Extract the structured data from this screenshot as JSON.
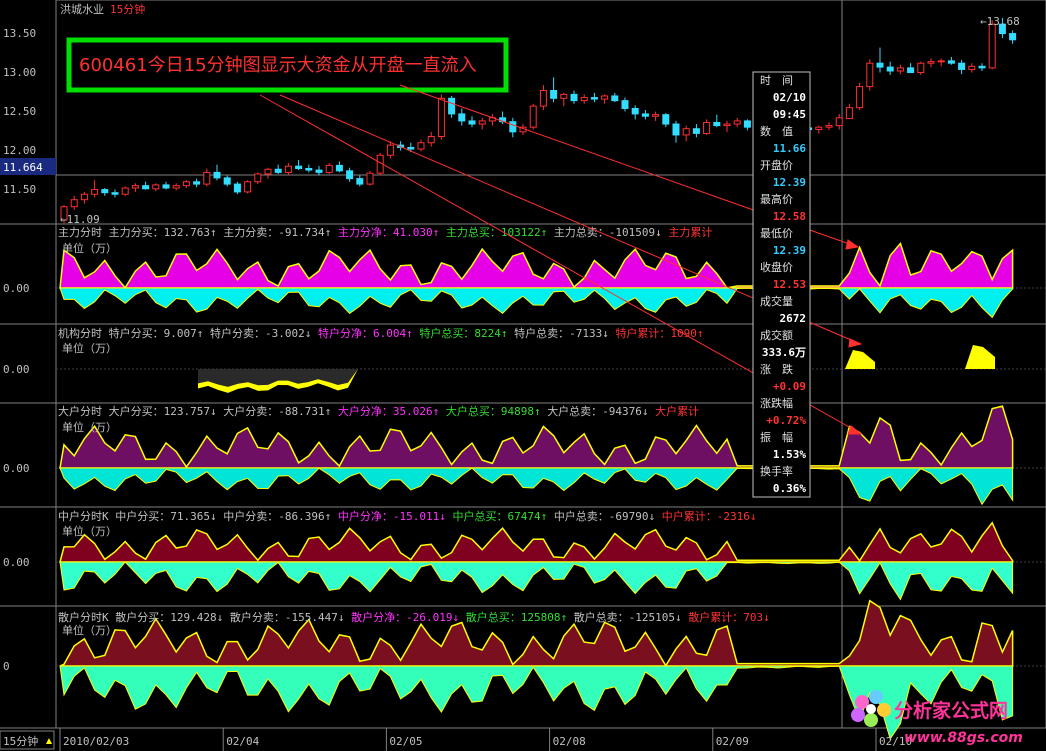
{
  "header": {
    "stock_name": "洪城水业",
    "period": "15分钟"
  },
  "annotation": "600461今日15分钟图显示大资金从开盘一直流入",
  "price_panel": {
    "y_ticks": [
      "13.50",
      "13.00",
      "12.50",
      "12.00",
      "11.50"
    ],
    "current_price": "11.664",
    "high_marker": "13.68",
    "low_marker": "11.09"
  },
  "panels": [
    {
      "id": "zhuli",
      "zero_label": "0.00",
      "unit": "单位（万）",
      "legend": [
        {
          "text": "主力分时",
          "color": "#c0c0c0"
        },
        {
          "text": "主力分买：132.763↑",
          "color": "#c0c0c0"
        },
        {
          "text": "主力分卖：-91.734↑",
          "color": "#c0c0c0"
        },
        {
          "text": "主力分净：41.030↑",
          "color": "#ff33ff"
        },
        {
          "text": "主力总买：103122↑",
          "color": "#33dd33"
        },
        {
          "text": "主力总卖：-101509↓",
          "color": "#c0c0c0"
        },
        {
          "text": "主力累计",
          "color": "#ff3333"
        }
      ]
    },
    {
      "id": "jigou",
      "zero_label": "0.00",
      "unit": "单位（万）",
      "legend": [
        {
          "text": "机构分时",
          "color": "#c0c0c0"
        },
        {
          "text": "特户分买：9.007↑",
          "color": "#c0c0c0"
        },
        {
          "text": "特户分卖：-3.002↓",
          "color": "#c0c0c0"
        },
        {
          "text": "特户分净：6.004↑",
          "color": "#ff33ff"
        },
        {
          "text": "特户总买：8224↑",
          "color": "#33dd33"
        },
        {
          "text": "特户总卖：-7133↓",
          "color": "#c0c0c0"
        },
        {
          "text": "特户累计：1090↑",
          "color": "#ff3333"
        }
      ]
    },
    {
      "id": "dahu",
      "zero_label": "0.00",
      "unit": "单位（万）",
      "legend": [
        {
          "text": "大户分时",
          "color": "#c0c0c0"
        },
        {
          "text": "大户分买：123.757↓",
          "color": "#c0c0c0"
        },
        {
          "text": "大户分卖：-88.731↑",
          "color": "#c0c0c0"
        },
        {
          "text": "大户分净：35.026↑",
          "color": "#ff33ff"
        },
        {
          "text": "大户总买：94898↑",
          "color": "#33dd33"
        },
        {
          "text": "大户总卖：-94376↓",
          "color": "#c0c0c0"
        },
        {
          "text": "大户累计",
          "color": "#ff3333"
        }
      ]
    },
    {
      "id": "zhonghu",
      "zero_label": "0.00",
      "unit": "单位（万）",
      "legend": [
        {
          "text": "中户分时K",
          "color": "#c0c0c0"
        },
        {
          "text": "中户分买：71.365↓",
          "color": "#c0c0c0"
        },
        {
          "text": "中户分卖：-86.396↑",
          "color": "#c0c0c0"
        },
        {
          "text": "中户分净：-15.011↓",
          "color": "#ff33ff"
        },
        {
          "text": "中户总买：67474↑",
          "color": "#33dd33"
        },
        {
          "text": "中户总卖：-69790↓",
          "color": "#c0c0c0"
        },
        {
          "text": "中户累计：-2316↓",
          "color": "#ff3333"
        }
      ]
    },
    {
      "id": "sanhu",
      "zero_label": "0",
      "unit": "单位（万）",
      "legend": [
        {
          "text": "散户分时K",
          "color": "#c0c0c0"
        },
        {
          "text": "散户分买：129.428↓",
          "color": "#c0c0c0"
        },
        {
          "text": "散户分卖：-155.447↓",
          "color": "#c0c0c0"
        },
        {
          "text": "散户分净：-26.019↓",
          "color": "#ff33ff"
        },
        {
          "text": "散户总买：125808↑",
          "color": "#33dd33"
        },
        {
          "text": "散户总卖：-125105↓",
          "color": "#c0c0c0"
        },
        {
          "text": "散户累计：703↓",
          "color": "#ff3333"
        }
      ]
    }
  ],
  "info_box": {
    "rows": [
      {
        "label": "时　间",
        "value": "02/10"
      },
      {
        "label": "",
        "value": "09:45"
      },
      {
        "label": "数　值",
        "value": "11.66",
        "value_color": "#33ccff"
      },
      {
        "label": "开盘价",
        "value": "12.39",
        "value_color": "#33ccff"
      },
      {
        "label": "最高价",
        "value": "12.58",
        "value_color": "#ff3333"
      },
      {
        "label": "最低价",
        "value": "12.39",
        "value_color": "#33ccff"
      },
      {
        "label": "收盘价",
        "value": "12.53",
        "value_color": "#ff3333"
      },
      {
        "label": "成交量",
        "value": "2672"
      },
      {
        "label": "成交额",
        "value": "333.6万"
      },
      {
        "label": "涨　跌",
        "value": "+0.09",
        "value_color": "#ff3333"
      },
      {
        "label": "涨跌幅",
        "value": "+0.72%",
        "value_color": "#ff3333"
      },
      {
        "label": "振　幅",
        "value": "1.53%"
      },
      {
        "label": "换手率",
        "value": "0.36%"
      }
    ]
  },
  "x_axis": {
    "period_button": "15分钟",
    "dates": [
      "2010/02/03",
      "02/04",
      "02/05",
      "02/08",
      "02/09",
      "02/10"
    ]
  },
  "watermark": {
    "brand": "分析家公式网",
    "url": "www.88gs.com"
  },
  "chart_data": {
    "type": "candlestick",
    "title": "洪城水业 15分钟",
    "y_range": [
      11.0,
      13.75
    ],
    "bars_per_day": 16,
    "days": [
      "2010/02/03",
      "02/04",
      "02/05",
      "02/08",
      "02/09",
      "02/10"
    ],
    "ohlc": [
      [
        11.09,
        11.28,
        11.05,
        11.26
      ],
      [
        11.26,
        11.4,
        11.22,
        11.35
      ],
      [
        11.35,
        11.45,
        11.3,
        11.42
      ],
      [
        11.42,
        11.6,
        11.38,
        11.48
      ],
      [
        11.48,
        11.5,
        11.4,
        11.44
      ],
      [
        11.44,
        11.48,
        11.38,
        11.42
      ],
      [
        11.42,
        11.52,
        11.4,
        11.5
      ],
      [
        11.5,
        11.56,
        11.45,
        11.53
      ],
      [
        11.53,
        11.58,
        11.48,
        11.49
      ],
      [
        11.49,
        11.56,
        11.46,
        11.54
      ],
      [
        11.54,
        11.58,
        11.48,
        11.5
      ],
      [
        11.5,
        11.56,
        11.47,
        11.53
      ],
      [
        11.53,
        11.6,
        11.5,
        11.58
      ],
      [
        11.58,
        11.62,
        11.51,
        11.55
      ],
      [
        11.55,
        11.75,
        11.52,
        11.7
      ],
      [
        11.7,
        11.8,
        11.6,
        11.63
      ],
      [
        11.63,
        11.66,
        11.52,
        11.55
      ],
      [
        11.55,
        11.58,
        11.42,
        11.45
      ],
      [
        11.45,
        11.6,
        11.43,
        11.58
      ],
      [
        11.58,
        11.7,
        11.55,
        11.68
      ],
      [
        11.68,
        11.76,
        11.62,
        11.74
      ],
      [
        11.74,
        11.8,
        11.68,
        11.7
      ],
      [
        11.7,
        11.82,
        11.66,
        11.78
      ],
      [
        11.78,
        11.86,
        11.73,
        11.75
      ],
      [
        11.75,
        11.8,
        11.7,
        11.73
      ],
      [
        11.73,
        11.78,
        11.66,
        11.7
      ],
      [
        11.7,
        11.82,
        11.68,
        11.79
      ],
      [
        11.79,
        11.84,
        11.7,
        11.72
      ],
      [
        11.72,
        11.76,
        11.58,
        11.62
      ],
      [
        11.62,
        11.66,
        11.52,
        11.55
      ],
      [
        11.55,
        11.72,
        11.53,
        11.69
      ],
      [
        11.69,
        11.95,
        11.66,
        11.92
      ],
      [
        11.92,
        12.1,
        11.88,
        12.05
      ],
      [
        12.05,
        12.1,
        11.98,
        12.02
      ],
      [
        12.02,
        12.08,
        11.96,
        12.0
      ],
      [
        12.0,
        12.12,
        11.97,
        12.08
      ],
      [
        12.08,
        12.22,
        12.03,
        12.16
      ],
      [
        12.16,
        12.7,
        12.12,
        12.65
      ],
      [
        12.65,
        12.68,
        12.4,
        12.45
      ],
      [
        12.45,
        12.52,
        12.3,
        12.36
      ],
      [
        12.36,
        12.42,
        12.28,
        12.32
      ],
      [
        12.32,
        12.4,
        12.25,
        12.36
      ],
      [
        12.36,
        12.45,
        12.3,
        12.4
      ],
      [
        12.4,
        12.48,
        12.32,
        12.35
      ],
      [
        12.35,
        12.4,
        12.15,
        12.22
      ],
      [
        12.22,
        12.32,
        12.18,
        12.28
      ],
      [
        12.28,
        12.58,
        12.25,
        12.55
      ],
      [
        12.55,
        12.82,
        12.5,
        12.75
      ],
      [
        12.75,
        12.92,
        12.6,
        12.65
      ],
      [
        12.65,
        12.72,
        12.55,
        12.7
      ],
      [
        12.7,
        12.75,
        12.58,
        12.62
      ],
      [
        12.62,
        12.7,
        12.58,
        12.66
      ],
      [
        12.66,
        12.72,
        12.6,
        12.64
      ],
      [
        12.64,
        12.7,
        12.58,
        12.68
      ],
      [
        12.68,
        12.72,
        12.6,
        12.62
      ],
      [
        12.62,
        12.66,
        12.48,
        12.52
      ],
      [
        12.52,
        12.56,
        12.38,
        12.45
      ],
      [
        12.45,
        12.5,
        12.38,
        12.42
      ],
      [
        12.42,
        12.48,
        12.36,
        12.44
      ],
      [
        12.44,
        12.46,
        12.28,
        12.32
      ],
      [
        12.32,
        12.36,
        12.08,
        12.18
      ],
      [
        12.18,
        12.3,
        12.1,
        12.26
      ],
      [
        12.26,
        12.32,
        12.15,
        12.2
      ],
      [
        12.2,
        12.38,
        12.18,
        12.34
      ],
      [
        12.34,
        12.44,
        12.28,
        12.3
      ],
      [
        12.3,
        12.36,
        12.22,
        12.32
      ],
      [
        12.32,
        12.4,
        12.28,
        12.36
      ],
      [
        12.36,
        12.38,
        12.24,
        12.28
      ],
      [
        12.28,
        12.32,
        12.2,
        12.24
      ],
      [
        12.24,
        12.3,
        12.18,
        12.26
      ],
      [
        12.26,
        12.32,
        12.2,
        12.22
      ],
      [
        12.22,
        12.28,
        12.15,
        12.24
      ],
      [
        12.24,
        12.3,
        12.2,
        12.27
      ],
      [
        12.27,
        12.32,
        12.22,
        12.25
      ],
      [
        12.25,
        12.3,
        12.2,
        12.28
      ],
      [
        12.28,
        12.34,
        12.24,
        12.3
      ],
      [
        12.3,
        12.45,
        12.25,
        12.4
      ],
      [
        12.39,
        12.58,
        12.39,
        12.53
      ],
      [
        12.53,
        12.85,
        12.5,
        12.8
      ],
      [
        12.8,
        13.15,
        12.75,
        13.1
      ],
      [
        13.1,
        13.3,
        12.98,
        13.05
      ],
      [
        13.05,
        13.12,
        12.95,
        13.0
      ],
      [
        13.0,
        13.08,
        12.96,
        13.04
      ],
      [
        13.04,
        13.1,
        12.98,
        12.98
      ],
      [
        12.98,
        13.12,
        12.95,
        13.1
      ],
      [
        13.1,
        13.16,
        13.05,
        13.12
      ],
      [
        13.12,
        13.16,
        13.06,
        13.13
      ],
      [
        13.13,
        13.18,
        13.08,
        13.1
      ],
      [
        13.1,
        13.14,
        12.96,
        13.02
      ],
      [
        13.02,
        13.1,
        12.98,
        13.06
      ],
      [
        13.06,
        13.1,
        13.0,
        13.04
      ],
      [
        13.04,
        13.65,
        13.02,
        13.6
      ],
      [
        13.6,
        13.68,
        13.42,
        13.48
      ],
      [
        13.48,
        13.52,
        13.35,
        13.4
      ]
    ],
    "series": [
      {
        "name": "主力",
        "buy_color": "#e600e6",
        "sell_color": "#00f0f0"
      },
      {
        "name": "机构",
        "buy_color": "#ffff00",
        "sell_color": "#ffff00"
      },
      {
        "name": "大户",
        "buy_color": "#6e0f63",
        "sell_color": "#00e5d5"
      },
      {
        "name": "中户",
        "buy_color": "#800020",
        "sell_color": "#33ffcc"
      },
      {
        "name": "散户",
        "buy_color": "#7a0f1f",
        "sell_color": "#33ffbb"
      }
    ]
  }
}
